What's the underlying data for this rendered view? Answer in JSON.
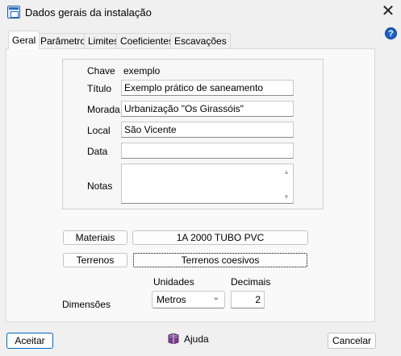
{
  "window": {
    "title": "Dados gerais da instalação",
    "close_glyph": "✕",
    "help_glyph": "?"
  },
  "tabs": [
    {
      "label": "Geral",
      "active": true
    },
    {
      "label": "Parâmetros",
      "active": false
    },
    {
      "label": "Limites",
      "active": false
    },
    {
      "label": "Coeficientes",
      "active": false
    },
    {
      "label": "Escavações",
      "active": false
    }
  ],
  "general": {
    "chave_label": "Chave",
    "chave_value": "exemplo",
    "titulo_label": "Título",
    "titulo_value": "Exemplo prático de saneamento",
    "morada_label": "Morada",
    "morada_value": "Urbanização \"Os Girassóis\"",
    "local_label": "Local",
    "local_value": "São Vicente",
    "data_label": "Data",
    "data_value": "",
    "notas_label": "Notas",
    "notas_value": ""
  },
  "materials": {
    "button_label": "Materiais",
    "value": "1A 2000 TUBO PVC"
  },
  "terrains": {
    "button_label": "Terrenos",
    "value": "Terrenos coesivos"
  },
  "dimensions": {
    "label": "Dimensões",
    "units_label": "Unidades",
    "units_value": "Metros",
    "decimals_label": "Decimais",
    "decimals_value": "2"
  },
  "footer": {
    "accept_label": "Aceitar",
    "help_label": "Ajuda",
    "cancel_label": "Cancelar"
  },
  "colors": {
    "accent": "#0067c0",
    "help_icon": "#1c62c4"
  },
  "icons": {
    "app": "window-icon",
    "close": "close-icon",
    "help": "help-icon",
    "book": "help-book-icon",
    "dropdown": "chevron-down-icon"
  }
}
